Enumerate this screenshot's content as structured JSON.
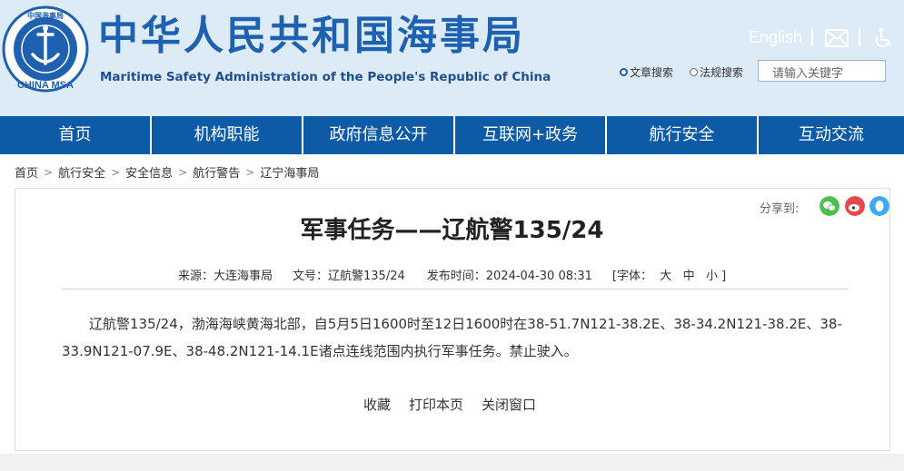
{
  "header": {
    "title_cn": "中华人民共和国海事局",
    "title_en": "Maritime Safety Administration of the People's Republic of China",
    "logo_text": "CHINA MSA",
    "logo_top_text": "中国海事局",
    "english_link": "English",
    "search_options": [
      "文章搜索",
      "法规搜索"
    ],
    "search_placeholder": "请输入关键字"
  },
  "nav": {
    "items": [
      "首页",
      "机构职能",
      "政府信息公开",
      "互联网+政务",
      "航行安全",
      "互动交流"
    ]
  },
  "breadcrumb": [
    "首页",
    "航行安全",
    "安全信息",
    "航行警告",
    "辽宁海事局"
  ],
  "share": {
    "label": "分享到:"
  },
  "article": {
    "title": "军事任务——辽航警135/24",
    "source": "来源：大连海事局",
    "doc_no": "文号：辽航警135/24",
    "publish_time": "发布时间：2024-04-30 08:31",
    "font_size": "[字体：  大   中   小 ]",
    "body": "辽航警135/24，渤海海峡黄海北部，自5月5日1600时至12日1600时在38-51.7N121-38.2E、38-34.2N121-38.2E、38-33.9N121-07.9E、38-48.2N121-14.1E诸点连线范围内执行军事任务。禁止驶入。"
  },
  "actions": [
    "收藏",
    "打印本页",
    "关闭窗口"
  ],
  "colors": {
    "header_bg": "#ddebf6",
    "nav_bg": "#0d5aa6",
    "brand_blue": "#1d61b0",
    "wechat": "#4cbf4c",
    "weibo": "#e5484d",
    "qq": "#3fa9f5"
  }
}
